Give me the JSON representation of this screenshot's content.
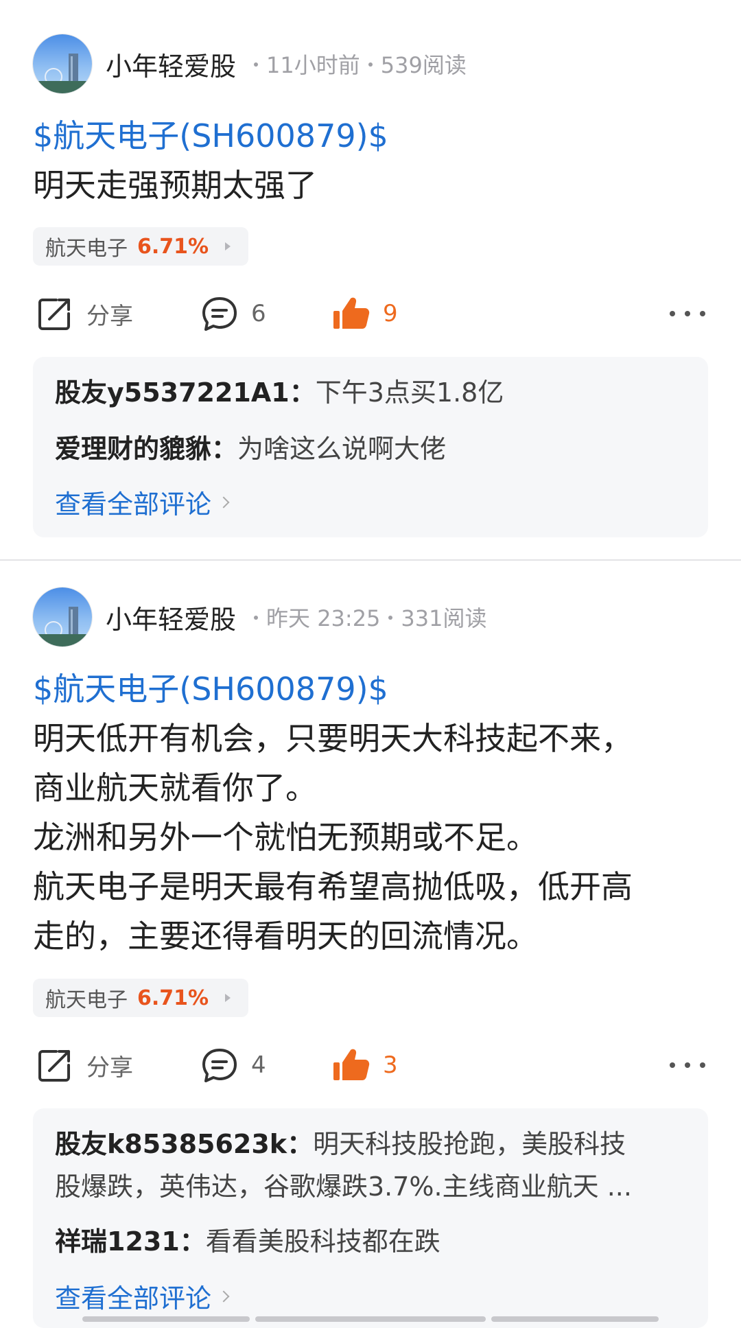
{
  "posts": [
    {
      "username": "小年轻爱股",
      "time": "11小时前",
      "reads": "539阅读",
      "stock_link": "$航天电子(SH600879)$",
      "lines": [
        "明天走强预期太强了"
      ],
      "chip": {
        "name": "航天电子",
        "percent": "6.71%"
      },
      "share_label": "分享",
      "comment_count": "6",
      "like_count": "9",
      "comments": [
        {
          "author": "股友y5537221A1：",
          "text": "下午3点买1.8亿"
        },
        {
          "author": "爱理财的貔貅：",
          "text": "为啥这么说啊大佬"
        }
      ],
      "see_all": "查看全部评论"
    },
    {
      "username": "小年轻爱股",
      "time": "昨天 23:25",
      "reads": "331阅读",
      "stock_link": "$航天电子(SH600879)$",
      "lines": [
        "明天低开有机会，只要明天大科技起不来，",
        "商业航天就看你了。",
        "龙洲和另外一个就怕无预期或不足。",
        "航天电子是明天最有希望高抛低吸，低开高",
        "走的，主要还得看明天的回流情况。"
      ],
      "chip": {
        "name": "航天电子",
        "percent": "6.71%"
      },
      "share_label": "分享",
      "comment_count": "4",
      "like_count": "3",
      "comments": [
        {
          "author": "股友k85385623k：",
          "text": "明天科技股抢跑，美股科技",
          "text2": "股爆跌，英伟达，谷歌爆跌3.7%.主线商业航天  ..."
        },
        {
          "author": "祥瑞1231：",
          "text": "看看美股科技都在跌"
        }
      ],
      "see_all": "查看全部评论"
    }
  ],
  "colors": {
    "link": "#1f6fd1",
    "like": "#ee6a1e",
    "percent": "#e8541d"
  },
  "icons": [
    "share-icon",
    "comment-icon",
    "thumbs-up-icon",
    "more-icon",
    "chevron-right-icon"
  ]
}
